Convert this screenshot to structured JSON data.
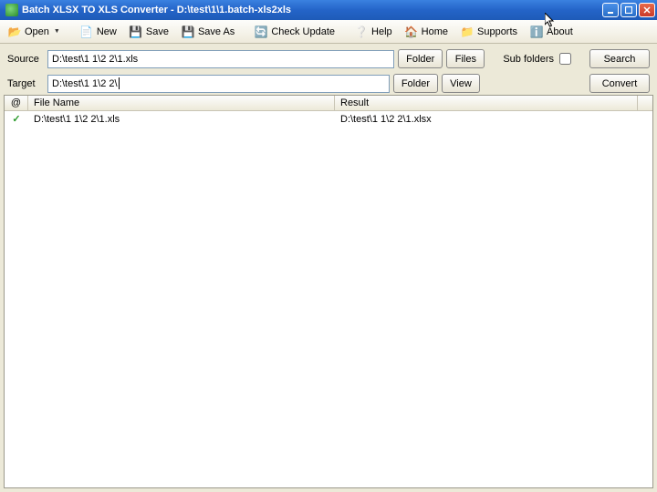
{
  "window": {
    "title": "Batch XLSX TO XLS Converter - D:\\test\\1\\1.batch-xls2xls"
  },
  "toolbar": {
    "open": "Open",
    "new": "New",
    "save": "Save",
    "saveas": "Save As",
    "check": "Check Update",
    "help": "Help",
    "home": "Home",
    "supports": "Supports",
    "about": "About"
  },
  "form": {
    "source_label": "Source",
    "source_value": "D:\\test\\1 1\\2 2\\1.xls",
    "target_label": "Target",
    "target_value": "D:\\test\\1 1\\2 2\\",
    "folder_btn": "Folder",
    "files_btn": "Files",
    "view_btn": "View",
    "subfolders_label": "Sub folders",
    "search_btn": "Search",
    "convert_btn": "Convert"
  },
  "list": {
    "col_at": "@",
    "col_filename": "File Name",
    "col_result": "Result",
    "rows": [
      {
        "status": "✓",
        "filename": "D:\\test\\1 1\\2 2\\1.xls",
        "result": "D:\\test\\1 1\\2 2\\1.xlsx"
      }
    ]
  }
}
